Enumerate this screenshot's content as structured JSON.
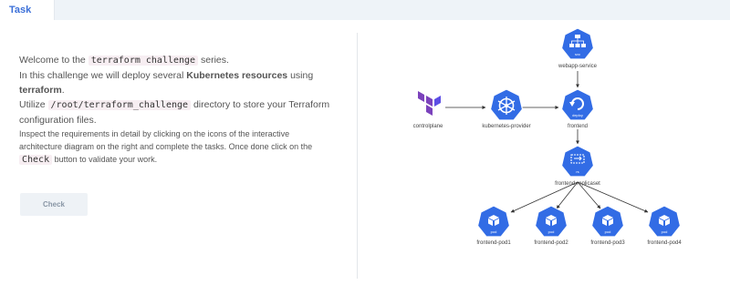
{
  "tab": {
    "label": "Task"
  },
  "intro": {
    "line1_pre": "Welcome to the ",
    "line1_code": "terraform challenge",
    "line1_post": " series.",
    "line2_pre": "In this challenge we will deploy several ",
    "line2_bold": "Kubernetes resources",
    "line2_post": " using",
    "line3_bold": "terraform",
    "line3_post": ".",
    "line4_pre": "Utilize ",
    "line4_code": "/root/terraform_challenge",
    "line4_post": " directory to store your Terraform",
    "line5": "configuration files.",
    "small1": "Inspect the requirements in detail by clicking on the icons of the interactive",
    "small2": "architecture diagram on the right and complete the tasks. Once done click on the",
    "small3_code": "Check",
    "small3_post": " button to validate your work."
  },
  "check_button": {
    "label": "Check"
  },
  "diagram": {
    "nodes": {
      "controlplane": {
        "label": "controlplane",
        "icon": "terraform-icon"
      },
      "provider": {
        "label": "kubernetes-provider",
        "icon": "kubernetes-icon"
      },
      "service": {
        "label": "webapp-service",
        "sub": "svc",
        "icon": "service-icon"
      },
      "deploy": {
        "label": "frontend",
        "sub": "deploy",
        "icon": "deployment-icon"
      },
      "rs": {
        "label": "frontend-replicaset",
        "sub": "rs",
        "icon": "replicaset-icon"
      },
      "pod1": {
        "label": "frontend-pod1",
        "sub": "pod",
        "icon": "pod-icon"
      },
      "pod2": {
        "label": "frontend-pod2",
        "sub": "pod",
        "icon": "pod-icon"
      },
      "pod3": {
        "label": "frontend-pod3",
        "sub": "pod",
        "icon": "pod-icon"
      },
      "pod4": {
        "label": "frontend-pod4",
        "sub": "pod",
        "icon": "pod-icon"
      }
    },
    "colors": {
      "k8s_blue": "#326ce5",
      "terraform_purple": "#7b42bc",
      "arrow": "#333333"
    }
  }
}
